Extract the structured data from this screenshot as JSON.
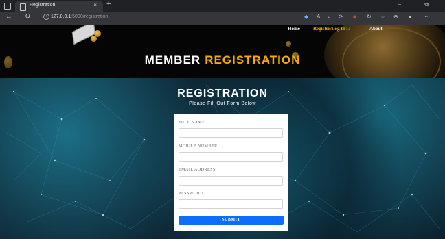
{
  "browser": {
    "tab_title": "Registration",
    "tab_close": "×",
    "new_tab": "+",
    "window_controls": "– ⧉",
    "back": "←",
    "refresh": "↻",
    "url_host": "127.0.0.1",
    "url_rest": ":5000/registration",
    "toolbar_icons": [
      "favorite-icon",
      "read-aloud-icon",
      "zoom-icon",
      "extensions-icon",
      "profile-icon",
      "refresh-icon",
      "favorites-bar-icon",
      "collections-icon",
      "copilot-icon",
      "more-icon"
    ]
  },
  "nav": {
    "home": "Home",
    "register_login": "Register/Log In",
    "register_icon": "□",
    "about": "About"
  },
  "hero": {
    "title_white": "MEMBER",
    "title_accent": "REGISTRATION"
  },
  "form": {
    "title": "REGISTRATION",
    "subtitle": "Please Fill Out Form Below",
    "full_name_label": "FULL NAME",
    "mobile_label": "MOBILE NUMBER",
    "email_label": "EMAIL ADDRESS",
    "password_label": "PASSWORD",
    "full_name_value": "",
    "mobile_value": "",
    "email_value": "",
    "password_value": "",
    "submit_label": "SUBMIT"
  },
  "colors": {
    "accent": "#f2a900",
    "submit": "#0d6efd",
    "hero_bg": "#050505",
    "page_bg": "#0a1823"
  }
}
